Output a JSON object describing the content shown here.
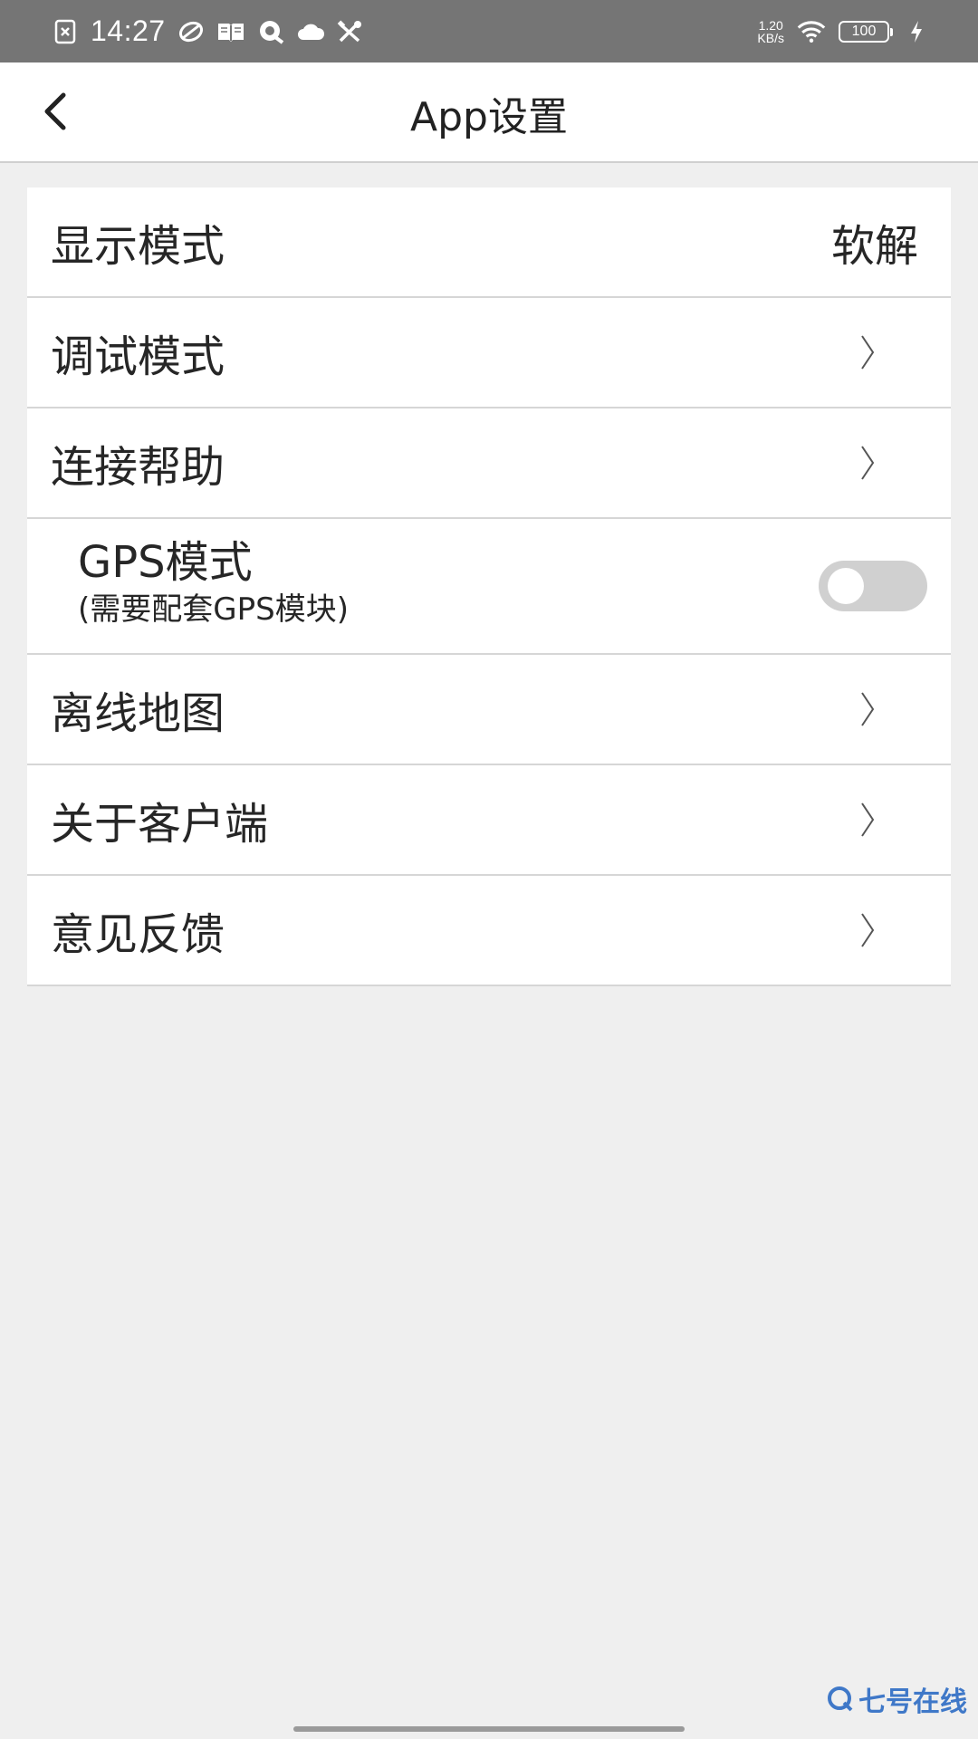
{
  "status_bar": {
    "time": "14:27",
    "net_speed_value": "1.20",
    "net_speed_unit": "KB/s",
    "battery": "100",
    "icons": [
      "sim-off-icon",
      "rotate-icon",
      "book-icon",
      "chat-icon",
      "cloud-icon",
      "tools-icon",
      "wifi-icon",
      "charging-icon"
    ]
  },
  "header": {
    "title": "App设置",
    "back_icon": "back-arrow-icon"
  },
  "settings": {
    "items": [
      {
        "label": "显示模式",
        "value": "软解"
      },
      {
        "label": "调试模式"
      },
      {
        "label": "连接帮助"
      },
      {
        "label": "GPS模式",
        "sublabel": "(需要配套GPS模块)",
        "toggle_on": false
      },
      {
        "label": "离线地图"
      },
      {
        "label": "关于客户端"
      },
      {
        "label": "意见反馈"
      }
    ]
  },
  "watermark": {
    "text": "七号在线"
  },
  "colors": {
    "status_bar_bg": "#757575",
    "page_bg": "#efefef",
    "toggle_off": "#d0d0d0",
    "watermark": "#3f78c8"
  }
}
